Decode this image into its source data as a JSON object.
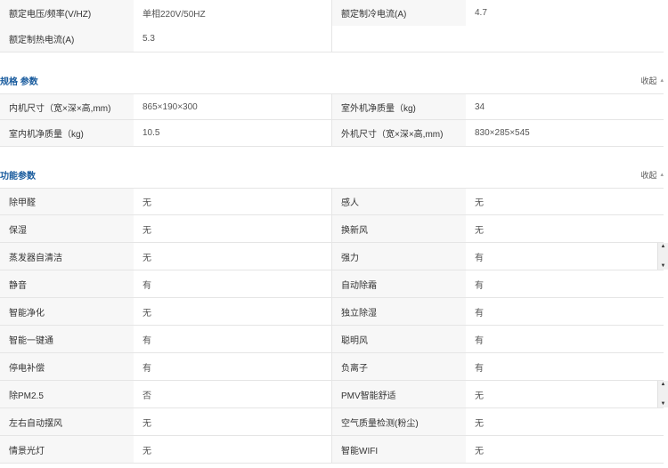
{
  "top_rows": [
    {
      "l1": "额定电压/频率(V/HZ)",
      "v1": "单相220V/50HZ",
      "l2": "额定制冷电流(A)",
      "v2": "4.7"
    },
    {
      "l1": "额定制热电流(A)",
      "v1": "5.3",
      "l2": "",
      "v2": ""
    }
  ],
  "spec": {
    "title": "规格 参数",
    "collapse": "收起",
    "rows": [
      {
        "l1": "内机尺寸（宽×深×高,mm)",
        "v1": "865×190×300",
        "l2": "室外机净质量（kg)",
        "v2": "34"
      },
      {
        "l1": "室内机净质量（kg)",
        "v1": "10.5",
        "l2": "外机尺寸（宽×深×高,mm)",
        "v2": "830×285×545"
      }
    ]
  },
  "func": {
    "title": "功能参数",
    "collapse": "收起",
    "rows": [
      {
        "l1": "除甲醛",
        "v1": "无",
        "l2": "感人",
        "v2": "无"
      },
      {
        "l1": "保湿",
        "v1": "无",
        "l2": "换新风",
        "v2": "无"
      },
      {
        "l1": "蒸发器自清洁",
        "v1": "无",
        "l2": "强力",
        "v2": "有"
      },
      {
        "l1": "静音",
        "v1": "有",
        "l2": "自动除霜",
        "v2": "有"
      },
      {
        "l1": "智能净化",
        "v1": "无",
        "l2": "独立除湿",
        "v2": "有"
      },
      {
        "l1": "智能一键通",
        "v1": "有",
        "l2": "聪明风",
        "v2": "有"
      },
      {
        "l1": "停电补偿",
        "v1": "有",
        "l2": "负离子",
        "v2": "有"
      },
      {
        "l1": "除PM2.5",
        "v1": "否",
        "l2": "PMV智能舒适",
        "v2": "无"
      },
      {
        "l1": "左右自动摆风",
        "v1": "无",
        "l2": "空气质量检测(粉尘)",
        "v2": "无"
      },
      {
        "l1": "情景光灯",
        "v1": "无",
        "l2": "智能WIFI",
        "v2": "无"
      }
    ]
  }
}
